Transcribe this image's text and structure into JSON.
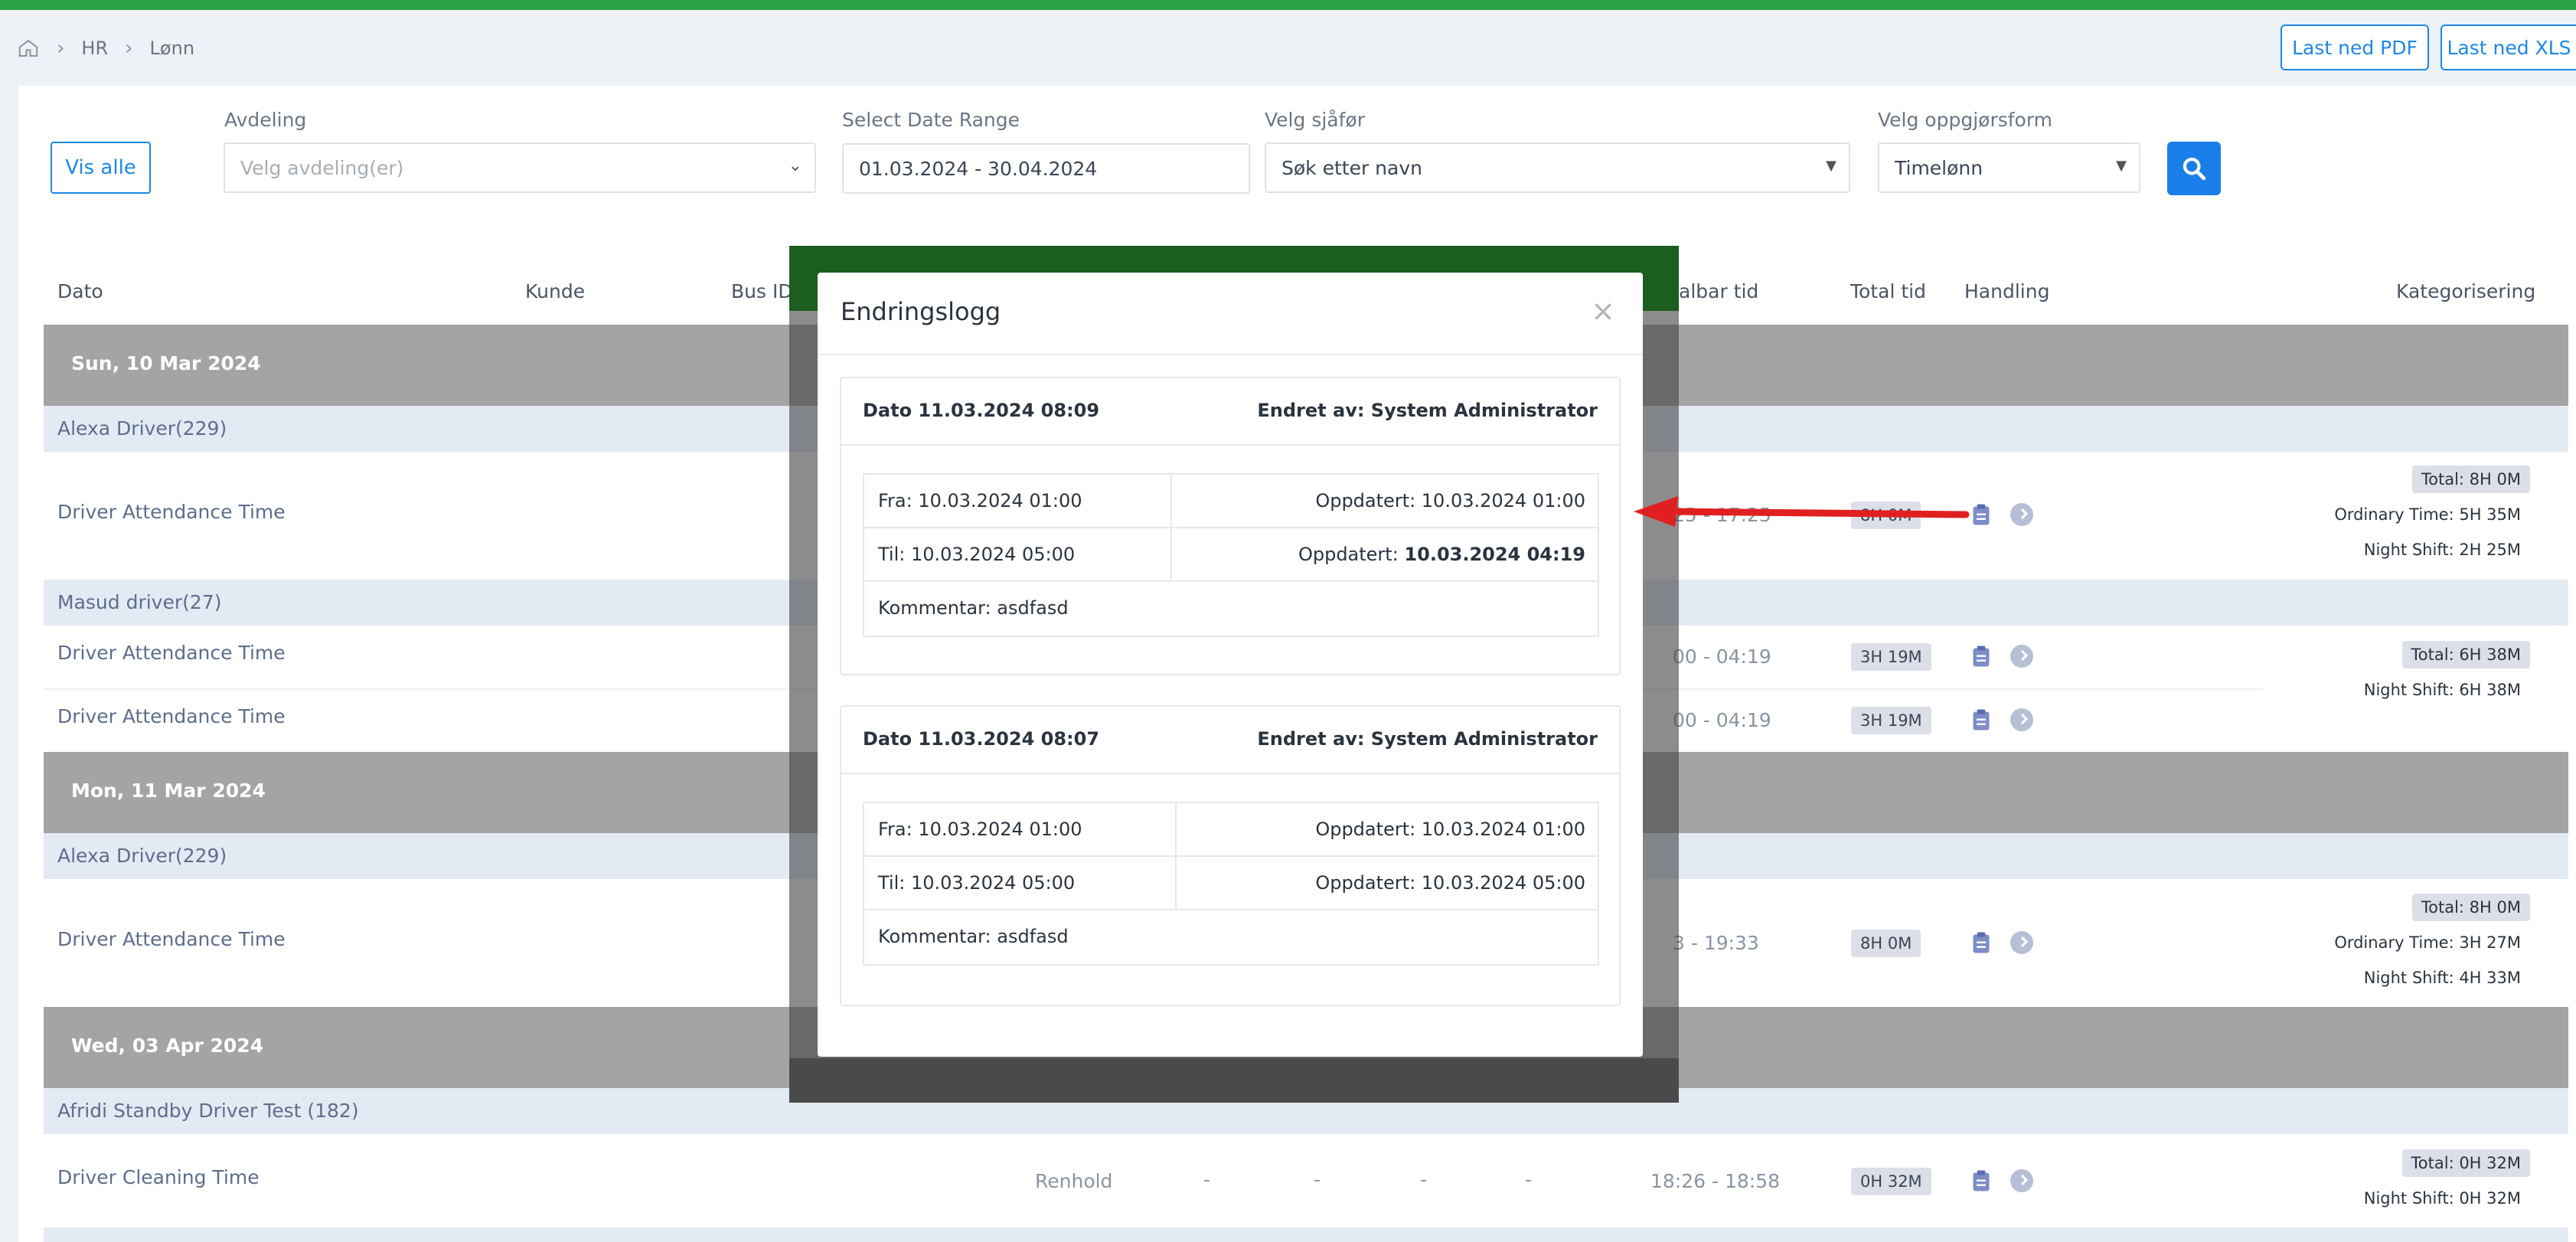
{
  "header": {
    "breadcrumb": [
      "HR",
      "Lønn"
    ],
    "pdf_button": "Last ned PDF",
    "xls_button": "Last ned XLS"
  },
  "filters": {
    "show_all": "Vis alle",
    "department_label": "Avdeling",
    "department_placeholder": "Velg avdeling(er)",
    "date_label": "Select Date Range",
    "date_value": "01.03.2024 - 30.04.2024",
    "driver_label": "Velg sjåfør",
    "driver_value": "Søk etter navn",
    "settlement_label": "Velg oppgjørsform",
    "settlement_value": "Timelønn"
  },
  "table": {
    "headers": {
      "date": "Dato",
      "customer": "Kunde",
      "bus": "Bus ID",
      "payable": "albar tid",
      "total": "Total tid",
      "action": "Handling",
      "category": "Kategorisering"
    },
    "days": [
      {
        "label": "Sun, 10 Mar 2024"
      },
      {
        "label": "Mon, 11 Mar 2024"
      },
      {
        "label": "Wed, 03 Apr 2024"
      }
    ],
    "persons": [
      "Alexa Driver(229)",
      "Masud driver(27)",
      "Alexa Driver(229)",
      "Afridi Standby Driver Test (182)"
    ],
    "rows": [
      {
        "type": "Driver Attendance Time",
        "time": "25 - 17:25",
        "total": "8H 0M",
        "tags": [
          "Total: 8H 0M",
          "Ordinary Time: 5H 35M",
          "Night Shift: 2H 25M"
        ]
      },
      {
        "type": "Driver Attendance Time",
        "time": "00 - 04:19",
        "total": "3H 19M",
        "tags": [
          "Total: 6H 38M",
          "Night Shift: 6H 38M"
        ]
      },
      {
        "type": "Driver Attendance Time",
        "time": "00 - 04:19",
        "total": "3H 19M"
      },
      {
        "type": "Driver Attendance Time",
        "time": "3 - 19:33",
        "total": "8H 0M",
        "tags": [
          "Total: 8H 0M",
          "Ordinary Time: 3H 27M",
          "Night Shift: 4H 33M"
        ]
      },
      {
        "type": "Driver Cleaning Time",
        "customer": "Renhold",
        "dashes": [
          "-",
          "-",
          "-",
          "-"
        ],
        "time": "18:26 - 18:58",
        "total": "0H 32M",
        "tags": [
          "Total: 0H 32M",
          "Night Shift: 0H 32M"
        ]
      }
    ]
  },
  "modal": {
    "title": "Endringslogg",
    "close": "×",
    "entries": [
      {
        "date": "Dato 11.03.2024 08:09",
        "by": "Endret av: System Administrator",
        "from": "Fra: 10.03.2024 01:00",
        "from_updated": "Oppdatert: 10.03.2024 01:00",
        "to": "Til: 10.03.2024 05:00",
        "to_updated_prefix": "Oppdatert: ",
        "to_updated_value": "10.03.2024 04:19",
        "comment": "Kommentar: asdfasd"
      },
      {
        "date": "Dato 11.03.2024 08:07",
        "by": "Endret av: System Administrator",
        "from": "Fra: 10.03.2024 01:00",
        "from_updated": "Oppdatert: 10.03.2024 01:00",
        "to": "Til: 10.03.2024 05:00",
        "to_updated": "Oppdatert: 10.03.2024 05:00",
        "comment": "Kommentar: asdfasd"
      }
    ]
  },
  "colors": {
    "accent": "#1e88e5",
    "topbar": "#2aa245",
    "annotation_arrow": "#e02020"
  }
}
